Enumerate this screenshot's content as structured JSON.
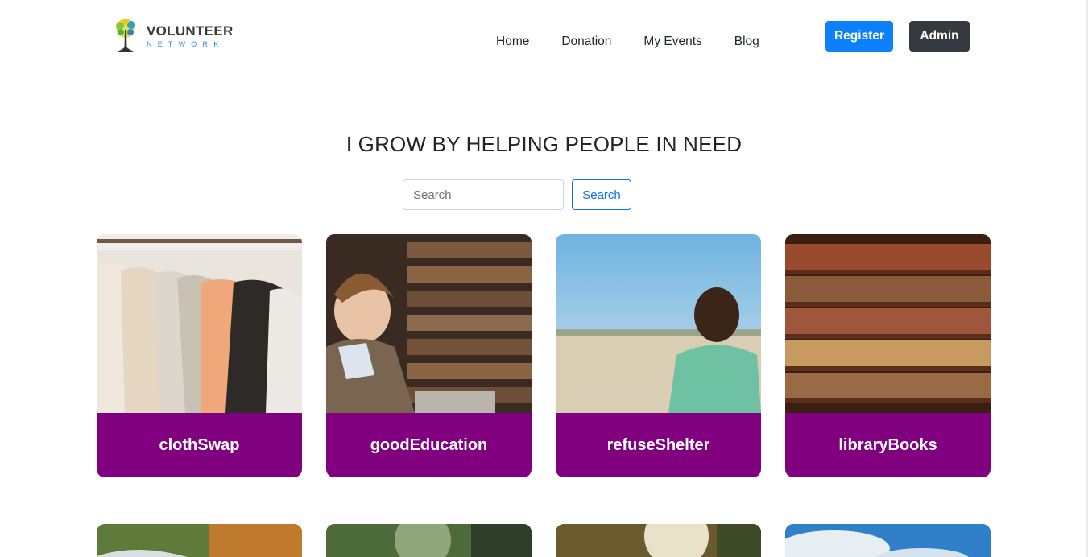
{
  "logo": {
    "main": "VOLUNTEER",
    "sub": "NETWORK"
  },
  "nav": {
    "items": [
      "Home",
      "Donation",
      "My Events",
      "Blog"
    ]
  },
  "buttons": {
    "register": "Register",
    "admin": "Admin"
  },
  "hero": {
    "headline": "I GROW BY HELPING PEOPLE IN NEED"
  },
  "search": {
    "placeholder": "Search",
    "button": "Search"
  },
  "cards": [
    {
      "title": "clothSwap",
      "image": "clothes-rack-image"
    },
    {
      "title": "goodEducation",
      "image": "boy-reading-library-image"
    },
    {
      "title": "refuseShelter",
      "image": "child-field-image"
    },
    {
      "title": "libraryBooks",
      "image": "bookshelf-image"
    }
  ],
  "colors": {
    "card_bar": "#800080",
    "register": "#0d80fb",
    "admin": "#343a40",
    "search_accent": "#0d6efd"
  }
}
